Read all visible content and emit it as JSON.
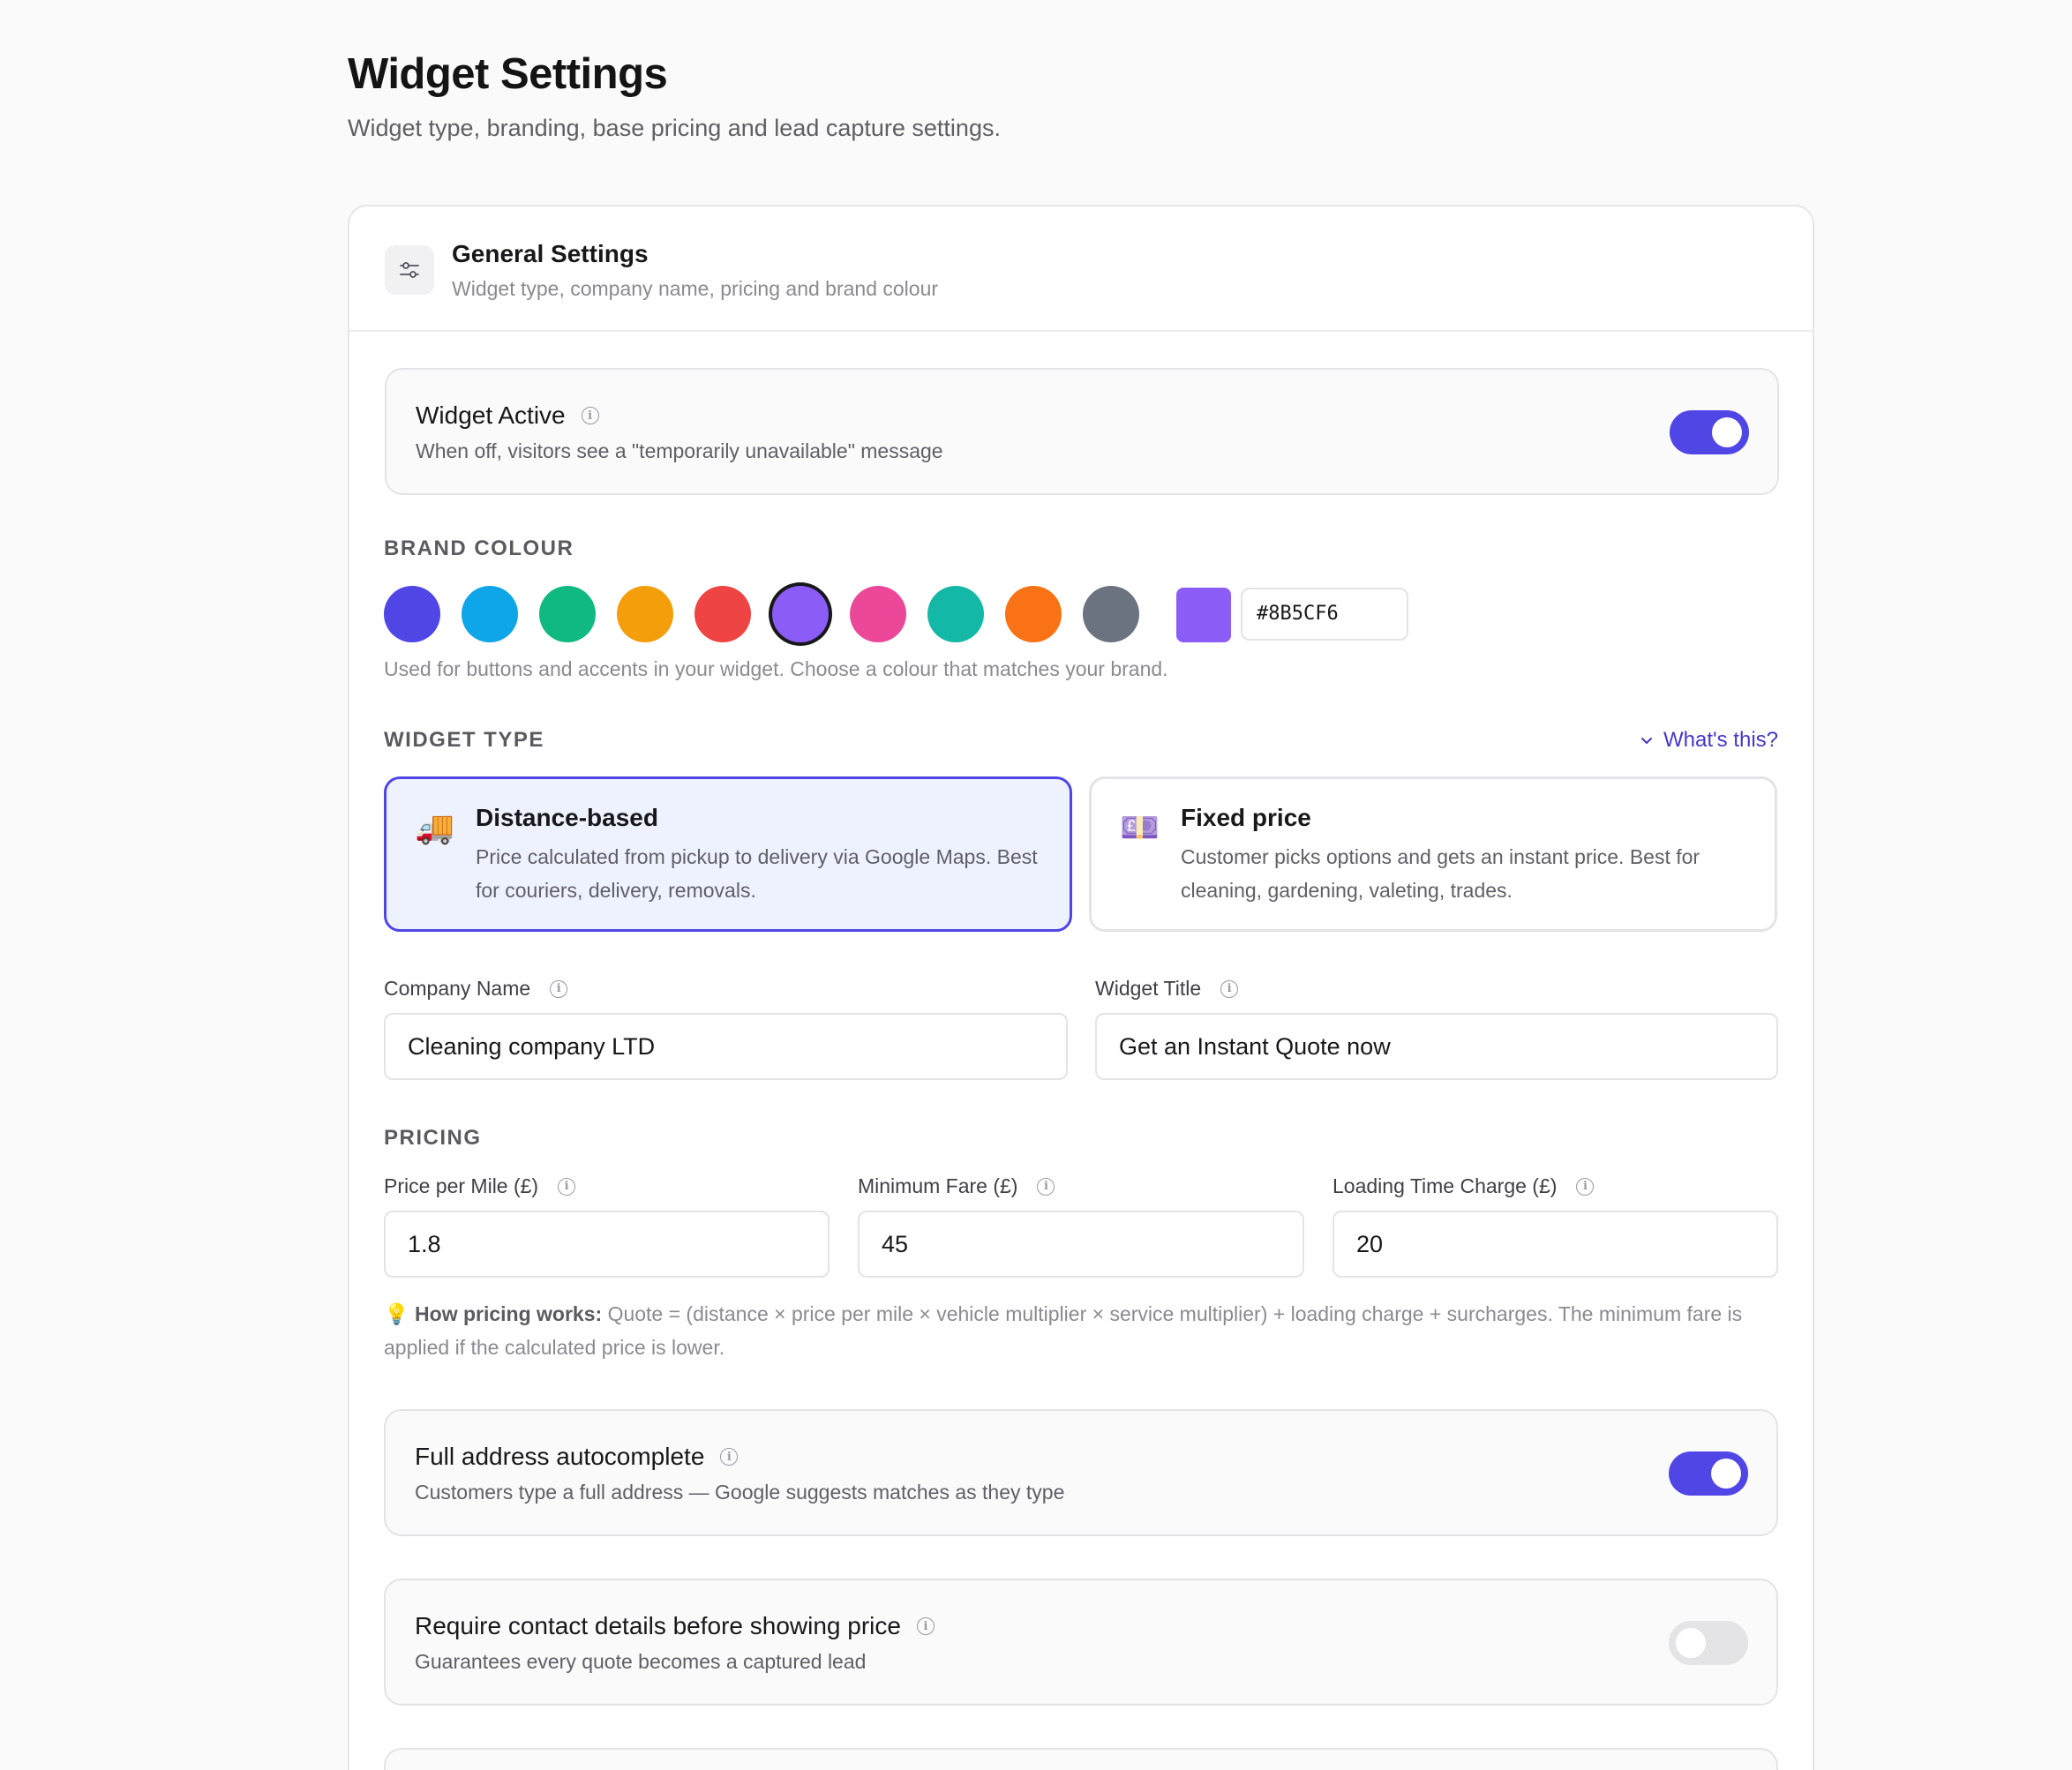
{
  "page": {
    "title": "Widget Settings",
    "subtitle": "Widget type, branding, base pricing and lead capture settings."
  },
  "general": {
    "title": "General Settings",
    "subtitle": "Widget type, company name, pricing and brand colour",
    "icon": "sliders-icon"
  },
  "widget_active": {
    "title": "Widget Active",
    "description": "When off, visitors see a \"temporarily unavailable\" message",
    "enabled": true
  },
  "brand_colour": {
    "label": "BRAND COLOUR",
    "swatches": [
      "#4f46e5",
      "#0ea5e9",
      "#10b981",
      "#f59e0b",
      "#ef4444",
      "#8b5cf6",
      "#ec4899",
      "#14b8a6",
      "#f97316",
      "#6b7280"
    ],
    "selected": "#8b5cf6",
    "hex_value": "#8B5CF6",
    "hint": "Used for buttons and accents in your widget. Choose a colour that matches your brand."
  },
  "widget_type": {
    "label": "WIDGET TYPE",
    "whats_this": "What's this?",
    "options": [
      {
        "emoji": "🚚",
        "title": "Distance-based",
        "description": "Price calculated from pickup to delivery via Google Maps. Best for couriers, delivery, removals.",
        "selected": true
      },
      {
        "emoji": "💷",
        "title": "Fixed price",
        "description": "Customer picks options and gets an instant price. Best for cleaning, gardening, valeting, trades.",
        "selected": false
      }
    ]
  },
  "company_name": {
    "label": "Company Name",
    "value": "Cleaning company LTD"
  },
  "widget_title": {
    "label": "Widget Title",
    "value": "Get an Instant Quote now"
  },
  "pricing": {
    "label": "PRICING",
    "price_per_mile": {
      "label": "Price per Mile (£)",
      "value": "1.8"
    },
    "minimum_fare": {
      "label": "Minimum Fare (£)",
      "value": "45"
    },
    "loading_charge": {
      "label": "Loading Time Charge (£)",
      "value": "20"
    },
    "how_icon": "💡",
    "how_title": "How pricing works:",
    "how_text": "Quote = (distance × price per mile × vehicle multiplier × service multiplier) + loading charge + surcharges. The minimum fare is applied if the calculated price is lower."
  },
  "address_autocomplete": {
    "title": "Full address autocomplete",
    "description": "Customers type a full address — Google suggests matches as they type",
    "enabled": true
  },
  "require_contact": {
    "title": "Require contact details before showing price",
    "description": "Guarantees every quote becomes a captured lead",
    "enabled": false
  }
}
